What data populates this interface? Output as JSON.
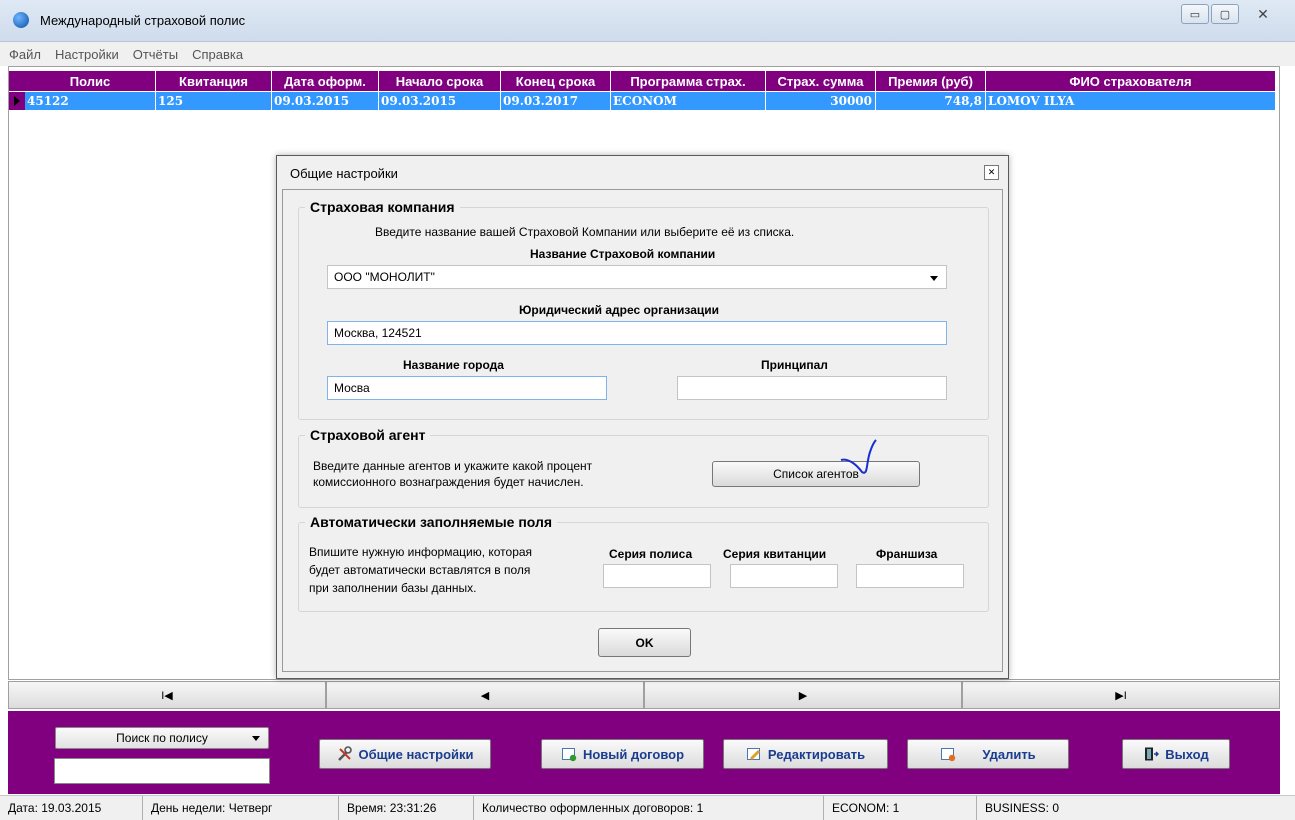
{
  "window": {
    "title": "Международный страховой полис",
    "minimize": "▭",
    "maximize": "▢",
    "close": "✕"
  },
  "menu": [
    "Файл",
    "Настройки",
    "Отчёты",
    "Справка"
  ],
  "grid": {
    "headers": [
      "Полис",
      "Квитанция",
      "Дата оформ.",
      "Начало срока",
      "Конец срока",
      "Программа страх.",
      "Страх. сумма",
      "Премия (руб)",
      "ФИО страхователя"
    ],
    "rows": [
      [
        "45122",
        "125",
        "09.03.2015",
        "09.03.2015",
        "09.03.2017",
        "ECONOM",
        "30000",
        "748,8",
        "LOMOV ILYA"
      ]
    ]
  },
  "navigator": [
    "I◀",
    "◀",
    "▶",
    "▶I"
  ],
  "bottom": {
    "search_mode": "Поиск по полису",
    "search_value": "",
    "btn_settings": "Общие настройки",
    "btn_new": "Новый договор",
    "btn_edit": "Редактировать",
    "btn_delete": "Удалить",
    "btn_exit": "Выход"
  },
  "status": {
    "date": "Дата: 19.03.2015",
    "weekday": "День недели: Четверг",
    "time": "Время: 23:31:26",
    "count": "Количество оформленных договоров: 1",
    "econom": "ECONOM: 1",
    "business": "BUSINESS: 0"
  },
  "dialog": {
    "title": "Общие настройки",
    "close": "✕",
    "company_group": "Страховая компания",
    "company_hint": "Введите название вашей Страховой Компании или выберите её из списка.",
    "company_name_label": "Название Страховой компании",
    "company_name_value": "ООО \"МОНОЛИТ\"",
    "address_label": "Юридический адрес организации",
    "address_value": "Москва, 124521",
    "city_label": "Название города",
    "city_value": "Мосва",
    "principal_label": "Принципал",
    "principal_value": "",
    "agent_group": "Страховой агент",
    "agent_hint_1": "Введите данные агентов и укажите какой процент",
    "agent_hint_2": "комиссионного вознаграждения будет начислен.",
    "agents_button": "Список агентов",
    "auto_group": "Автоматически заполняемые поля",
    "auto_hint_1": "Впишите нужную информацию, которая",
    "auto_hint_2": "будет автоматически вставлятся в поля",
    "auto_hint_3": "при заполнении базы данных.",
    "policy_series_label": "Серия полиса",
    "receipt_series_label": "Серия квитанции",
    "franchise_label": "Франшиза",
    "policy_series_value": "",
    "receipt_series_value": "",
    "franchise_value": "",
    "ok": "OK"
  },
  "colors": {
    "accent": "#800080",
    "selection": "#3399ff",
    "button_text": "#1a3d8f"
  }
}
